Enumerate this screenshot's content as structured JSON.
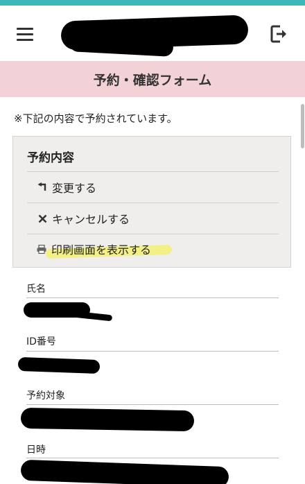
{
  "header": {
    "title": "予約・確認フォーム",
    "menu_icon": "hamburger-menu-icon",
    "logout_icon": "logout-icon"
  },
  "notice": "※下記の内容で予約されています。",
  "reservation_panel": {
    "title": "予約内容",
    "actions": [
      {
        "icon": "return-arrow-icon",
        "label": "変更する"
      },
      {
        "icon": "close-icon",
        "label": "キャンセルする"
      },
      {
        "icon": "printer-icon",
        "label": "印刷画面を表示する"
      }
    ]
  },
  "details": {
    "fields": [
      {
        "label": "氏名"
      },
      {
        "label": "ID番号"
      },
      {
        "label": "予約対象"
      },
      {
        "label": "日時"
      }
    ]
  },
  "colors": {
    "accent_strip": "#3fb6b8",
    "title_bar": "#f3d2d7",
    "panel_bg": "#efeeec",
    "highlight": "#f3f07a"
  }
}
